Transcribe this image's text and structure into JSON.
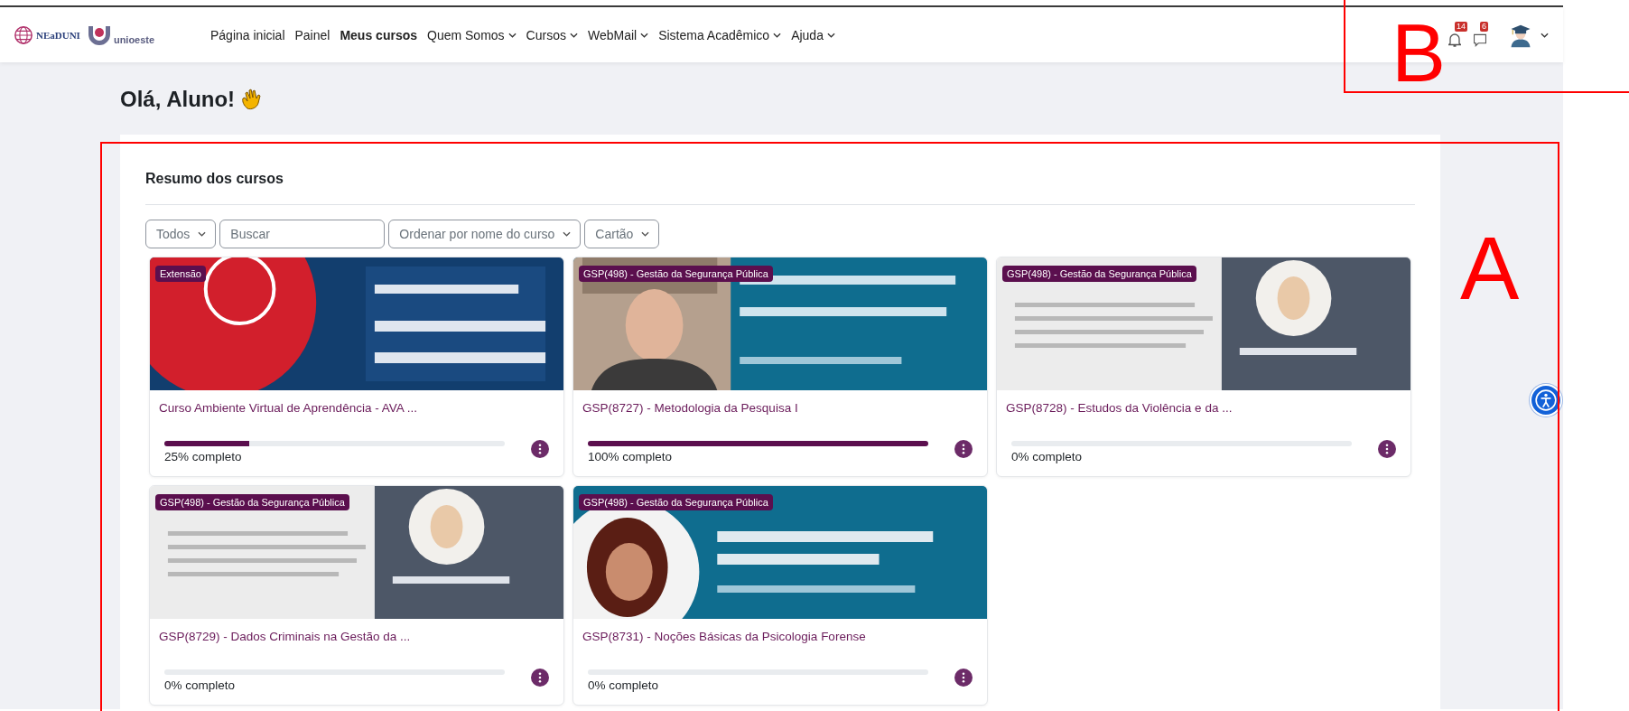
{
  "logos": [
    {
      "name": "NEaDUNI"
    },
    {
      "name": "unioeste"
    }
  ],
  "nav": {
    "items": [
      {
        "label": "Página inicial",
        "dropdown": false,
        "selected": false
      },
      {
        "label": "Painel",
        "dropdown": false,
        "selected": false
      },
      {
        "label": "Meus cursos",
        "dropdown": false,
        "selected": true
      },
      {
        "label": "Quem Somos",
        "dropdown": true,
        "selected": false
      },
      {
        "label": "Cursos",
        "dropdown": true,
        "selected": false
      },
      {
        "label": "WebMail",
        "dropdown": true,
        "selected": false
      },
      {
        "label": "Sistema Acadêmico",
        "dropdown": true,
        "selected": false
      },
      {
        "label": "Ajuda",
        "dropdown": true,
        "selected": false
      }
    ]
  },
  "notifications": {
    "count": "14"
  },
  "messages": {
    "count": "6"
  },
  "greeting": "Olá, Aluno!",
  "overview": {
    "title": "Resumo dos cursos",
    "filters": [
      {
        "kind": "dropdown",
        "label": "Todos"
      },
      {
        "kind": "search",
        "placeholder": "Buscar"
      },
      {
        "kind": "dropdown",
        "label": "Ordenar por nome do curso"
      },
      {
        "kind": "dropdown",
        "label": "Cartão"
      }
    ],
    "courses": [
      {
        "category": "Extensão",
        "name": "Curso Ambiente Virtual de Aprendência - AVA ...",
        "level": 0.25,
        "progress": "25% completo"
      },
      {
        "category": "GSP(498) - Gestão da Segurança Pública",
        "name": "GSP(8727) - Metodologia da Pesquisa I",
        "level": 1,
        "progress": "100% completo"
      },
      {
        "category": "GSP(498) - Gestão da Segurança Pública",
        "name": "GSP(8728) - Estudos da Violência e da ...",
        "level": 0,
        "progress": "0% completo"
      },
      {
        "category": "GSP(498) - Gestão da Segurança Pública",
        "name": "GSP(8729) - Dados Criminais na Gestão da ...",
        "level": 0,
        "progress": "0% completo"
      },
      {
        "category": "GSP(498) - Gestão da Segurança Pública",
        "name": "GSP(8731) - Noções Básicas da Psicologia Forense",
        "level": 0,
        "progress": "0% completo"
      }
    ]
  },
  "annotations": [
    {
      "kind": "main",
      "label": "A"
    },
    {
      "kind": "header",
      "label": "B"
    }
  ]
}
